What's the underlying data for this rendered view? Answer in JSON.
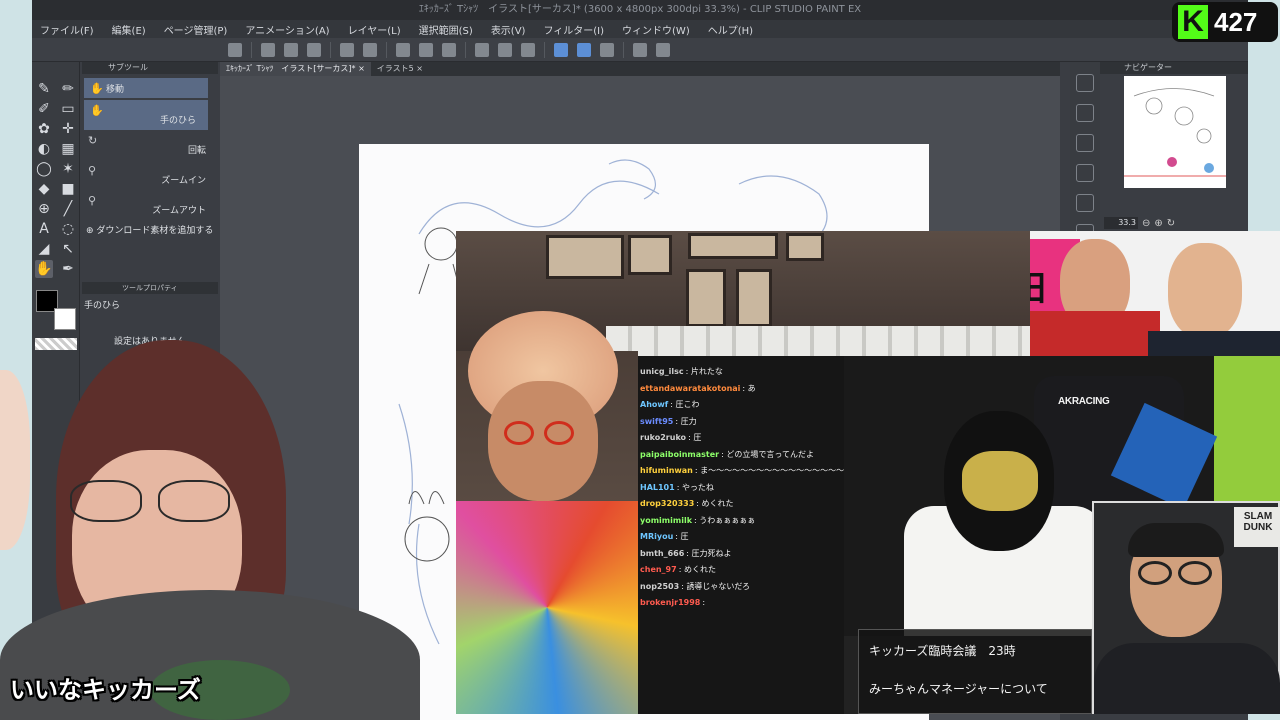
{
  "window": {
    "title": "ｴｷｯｶｰｽﾞ Tｼｬﾂ　イラスト[サーカス]* (3600 x 4800px 300dpi 33.3%)  - CLIP STUDIO PAINT EX"
  },
  "menubar": [
    "ファイル(F)",
    "編集(E)",
    "ページ管理(P)",
    "アニメーション(A)",
    "レイヤー(L)",
    "選択範囲(S)",
    "表示(V)",
    "フィルター(I)",
    "ウィンドウ(W)",
    "ヘルプ(H)"
  ],
  "subtool_panel": {
    "tab": "サブツール",
    "items": [
      {
        "label": "移動",
        "icon": "hand-icon"
      },
      {
        "label": "手のひら",
        "icon": "hand-icon"
      },
      {
        "label": "回転",
        "icon": "rotate-icon"
      },
      {
        "label": "ズームイン",
        "icon": "zoom-in-icon"
      },
      {
        "label": "ズームアウト",
        "icon": "zoom-out-icon"
      }
    ],
    "add_material": "ダウンロード素材を追加する"
  },
  "tool_property": {
    "tab": "ツールプロパティ",
    "tool_name": "手のひら",
    "empty_message": "設定はありません。"
  },
  "doc_tabs": [
    "ｴｷｯｶｰｽﾞ Tｼｬﾂ　イラスト[サーカス]*",
    "イラスト5"
  ],
  "navigator": {
    "tab": "ナビゲーター",
    "zoom": "33.3"
  },
  "chat": [
    {
      "user": "unicg_ilsc",
      "text": "片れたな",
      "color": "#cfcfcf"
    },
    {
      "user": "ettandawaratakotonai",
      "text": "あ",
      "color": "#ff8a3d"
    },
    {
      "user": "Ahowf",
      "text": "圧こわ",
      "color": "#6ec6ff"
    },
    {
      "user": "swift95",
      "text": "圧力",
      "color": "#6b8cff"
    },
    {
      "user": "ruko2ruko",
      "text": "圧",
      "color": "#cfcfcf"
    },
    {
      "user": "paipaiboinmaster",
      "text": "どの立場で言ってんだよ",
      "color": "#8dff6a"
    },
    {
      "user": "hifuminwan",
      "text": "ま〜〜〜〜〜〜〜〜〜〜〜〜〜〜〜〜〜〜〜〜〜〜〜〜〜〜〜〜〜〜〜〜〜〜〜〜〜〜〜〜〜〜〜〜〜〜〜〜〜〜〜たすお",
      "color": "#ffd13d"
    },
    {
      "user": "HAL101",
      "text": "やったね",
      "color": "#6ec6ff"
    },
    {
      "user": "drop320333",
      "text": "めくれた",
      "color": "#ffd13d"
    },
    {
      "user": "yomimimilk",
      "text": "うわぁぁぁぁぁ",
      "color": "#8dff6a"
    },
    {
      "user": "MRiyou",
      "text": "圧",
      "color": "#6ec6ff"
    },
    {
      "user": "bmth_666",
      "text": "圧力死ねよ",
      "color": "#cfcfcf"
    },
    {
      "user": "chen_97",
      "text": "めくれた",
      "color": "#ff5b4f"
    },
    {
      "user": "nop2503",
      "text": "誘導じゃないだろ",
      "color": "#cfcfcf"
    },
    {
      "user": "brokenjr1998",
      "text": "",
      "color": "#ff5b4f"
    }
  ],
  "chat_overlay_value": "1.00",
  "webcam": {
    "banner_text": "野田",
    "akracing": "AKRACING",
    "slam_dunk": "SLAM DUNK"
  },
  "notice": {
    "line1": "キッカーズ臨時会議　23時",
    "line2": "みーちゃんマネージャーについて"
  },
  "caption": "いいなキッカーズ",
  "kick": {
    "logo": "K",
    "viewers": "427"
  }
}
